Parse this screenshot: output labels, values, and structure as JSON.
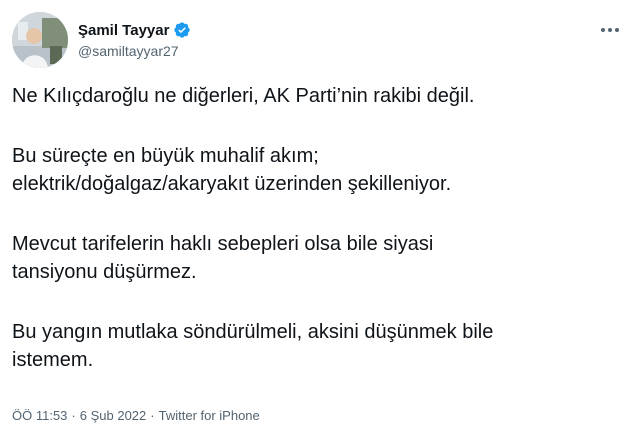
{
  "user": {
    "display_name": "Şamil Tayyar",
    "handle": "@samiltayyar27",
    "verified": true
  },
  "tweet": {
    "paragraphs": [
      "Ne Kılıçdaroğlu ne diğerleri, AK Parti’nin rakibi değil.",
      "Bu süreçte en büyük muhalif akım;\nelektrik/doğalgaz/akaryakıt üzerinden şekilleniyor.",
      "Mevcut tarifelerin haklı sebepleri olsa bile siyasi\ntansiyonu düşürmez.",
      "Bu yangın mutlaka söndürülmeli, aksini düşünmek bile\nistemem."
    ]
  },
  "meta": {
    "time": "ÖÖ 11:53",
    "separator": "·",
    "date": "6 Şub 2022",
    "source": "Twitter for iPhone"
  },
  "colors": {
    "accent": "#1d9bf0",
    "text": "#0f1419",
    "secondary": "#536471"
  },
  "icons": {
    "verified": "verified-badge-icon",
    "more": "more-horizontal-icon"
  }
}
